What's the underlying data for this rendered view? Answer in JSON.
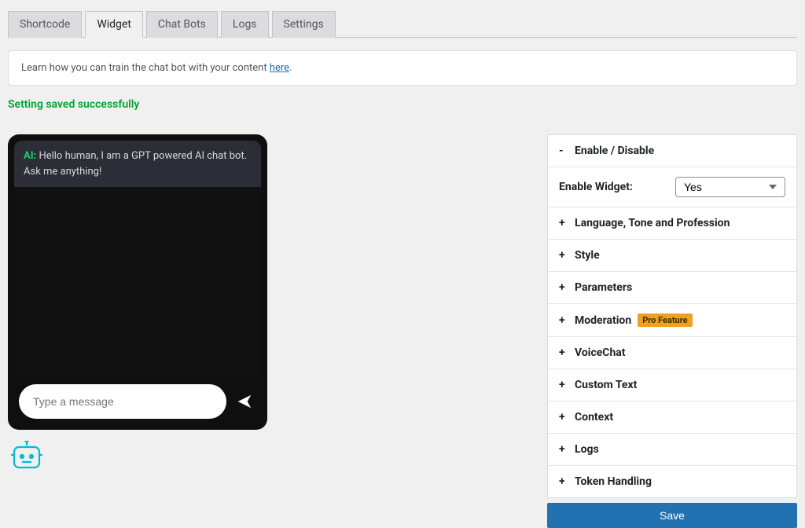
{
  "tabs": {
    "shortcode": "Shortcode",
    "widget": "Widget",
    "chatbots": "Chat Bots",
    "logs": "Logs",
    "settings": "Settings"
  },
  "info": {
    "text_prefix": "Learn how you can train the chat bot with your content ",
    "link_text": "here",
    "text_suffix": "."
  },
  "success_message": "Setting saved successfully",
  "chat": {
    "ai_label": "AI:",
    "greeting": "Hello human, I am a GPT powered AI chat bot. Ask me anything!",
    "placeholder": "Type a message"
  },
  "panel": {
    "section_enable": {
      "toggle": "-",
      "title": "Enable / Disable",
      "enable_widget_label": "Enable Widget:",
      "enable_widget_value": "Yes"
    },
    "sections": [
      {
        "toggle": "+",
        "title": "Language, Tone and Profession"
      },
      {
        "toggle": "+",
        "title": "Style"
      },
      {
        "toggle": "+",
        "title": "Parameters"
      },
      {
        "toggle": "+",
        "title": "Moderation",
        "badge": "Pro Feature"
      },
      {
        "toggle": "+",
        "title": "VoiceChat"
      },
      {
        "toggle": "+",
        "title": "Custom Text"
      },
      {
        "toggle": "+",
        "title": "Context"
      },
      {
        "toggle": "+",
        "title": "Logs"
      },
      {
        "toggle": "+",
        "title": "Token Handling"
      }
    ],
    "save_label": "Save"
  }
}
